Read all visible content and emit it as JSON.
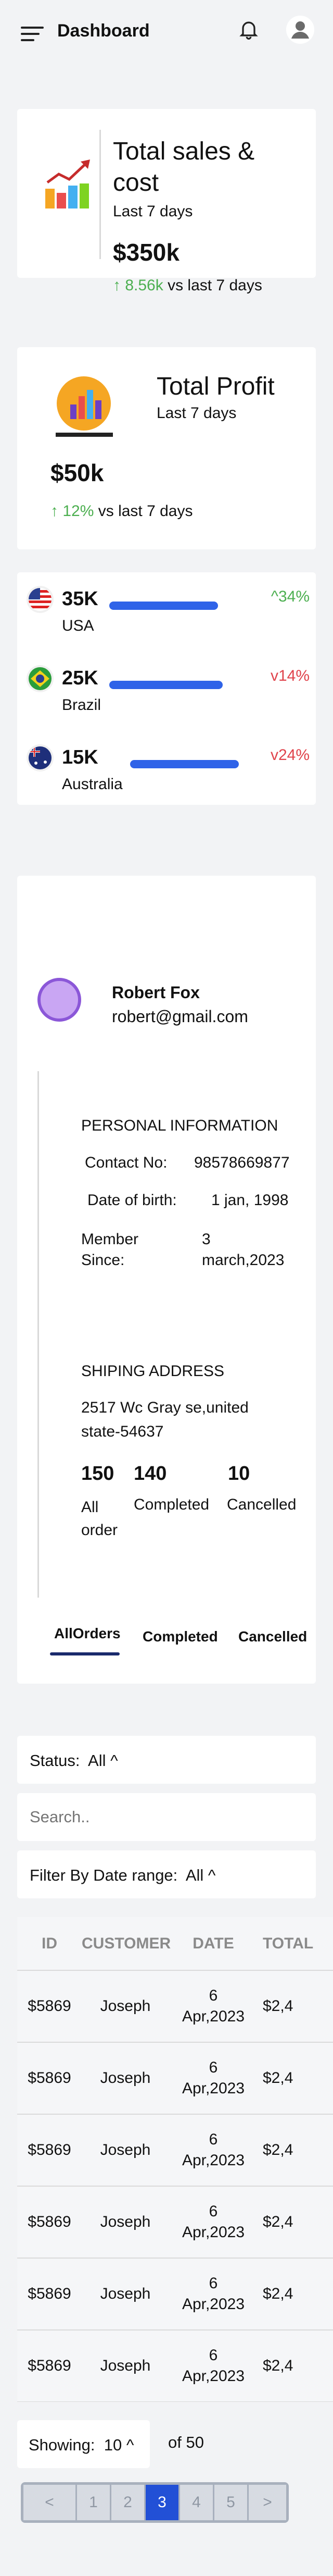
{
  "header": {
    "title": "Dashboard",
    "icons": [
      "menu-icon",
      "bell-icon",
      "user-icon"
    ]
  },
  "sales_card": {
    "title_line1": "Total sales &",
    "title_line2": "cost",
    "period": "Last 7 days",
    "value": "$350k",
    "delta": "8.56k",
    "delta_arrow": "↑",
    "compare": "vs last 7 days"
  },
  "profit_card": {
    "title": "Total Profit",
    "period": "Last 7 days",
    "value": "$50k",
    "delta": "12%",
    "delta_arrow": "↑",
    "compare": "vs last 7 days"
  },
  "countries": [
    {
      "value": "35K",
      "name": "USA",
      "percent": "34%",
      "arrow": "^",
      "trend": "up",
      "bar_fraction": 0.72
    },
    {
      "value": "25K",
      "name": "Brazil",
      "percent": "14%",
      "arrow": "v",
      "trend": "down",
      "bar_fraction": 0.75
    },
    {
      "value": "15K",
      "name": "Australia",
      "percent": "24%",
      "arrow": "v",
      "trend": "down",
      "bar_fraction": 0.72
    }
  ],
  "profile": {
    "name": "Robert Fox",
    "email": "robert@gmail.com",
    "personal_heading": "PERSONAL INFORMATION",
    "contact_label": "Contact No:",
    "contact_value": "98578669877",
    "dob_label": "Date of birth:",
    "dob_value": "1 jan, 1998",
    "member_label_1": "Member",
    "member_label_2": "Since:",
    "member_value_1": "3",
    "member_value_2": "march,2023",
    "shipping_heading": "SHIPING ADDRESS",
    "address_line1": "2517 Wc Gray se,united",
    "address_line2": "state-54637",
    "stats": [
      {
        "value": "150",
        "label_1": "All",
        "label_2": "order"
      },
      {
        "value": "140",
        "label_1": "Completed",
        "label_2": ""
      },
      {
        "value": "10",
        "label_1": "Cancelled",
        "label_2": ""
      }
    ]
  },
  "tabs": [
    "AllOrders",
    "Completed",
    "Cancelled"
  ],
  "filters": {
    "status_label": "Status:",
    "status_value": "All ^",
    "search_placeholder": "Search..",
    "date_label": "Filter By Date range:",
    "date_value": "All ^"
  },
  "table": {
    "columns": [
      "ID",
      "CUSTOMER",
      "DATE",
      "TOTAL"
    ],
    "rows": [
      {
        "id": "$5869",
        "customer": "Joseph",
        "date_1": "6",
        "date_2": "Apr,2023",
        "total": "$2,4"
      },
      {
        "id": "$5869",
        "customer": "Joseph",
        "date_1": "6",
        "date_2": "Apr,2023",
        "total": "$2,4"
      },
      {
        "id": "$5869",
        "customer": "Joseph",
        "date_1": "6",
        "date_2": "Apr,2023",
        "total": "$2,4"
      },
      {
        "id": "$5869",
        "customer": "Joseph",
        "date_1": "6",
        "date_2": "Apr,2023",
        "total": "$2,4"
      },
      {
        "id": "$5869",
        "customer": "Joseph",
        "date_1": "6",
        "date_2": "Apr,2023",
        "total": "$2,4"
      },
      {
        "id": "$5869",
        "customer": "Joseph",
        "date_1": "6",
        "date_2": "Apr,2023",
        "total": "$2,4"
      }
    ]
  },
  "pagination": {
    "showing_label": "Showing:",
    "showing_value": "10 ^",
    "of_label": "of 50",
    "prev": "<",
    "next": ">",
    "pages": [
      "1",
      "2",
      "3",
      "4",
      "5"
    ],
    "active_page": "3"
  },
  "colors": {
    "accent": "#2f63e8",
    "up": "#4caf50",
    "down": "#e0434b",
    "active_page": "#2250d6"
  }
}
